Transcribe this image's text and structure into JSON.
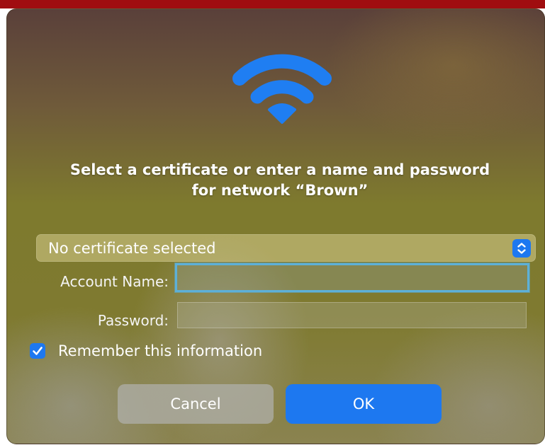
{
  "dialog": {
    "icon": "wifi-icon",
    "title_line1": "Select a certificate or enter a name and password",
    "title_line2": "for network “Brown”",
    "certificate_select": {
      "selected": "No certificate selected",
      "icon": "stepper-chevrons-icon"
    },
    "account_name": {
      "label": "Account Name:",
      "value": ""
    },
    "password": {
      "label": "Password:",
      "value": ""
    },
    "remember": {
      "label": "Remember this information",
      "checked": true
    },
    "buttons": {
      "cancel": "Cancel",
      "ok": "OK"
    }
  },
  "colors": {
    "accent": "#1d78f0",
    "focus_ring": "#5db0d8",
    "top_bar": "#a00d10"
  }
}
